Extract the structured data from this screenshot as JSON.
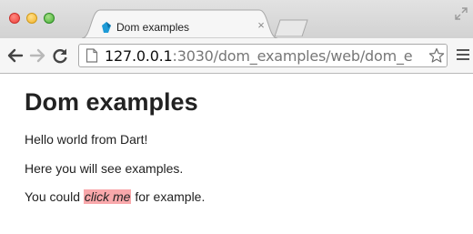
{
  "tab": {
    "title": "Dom examples",
    "close": "×"
  },
  "address_bar": {
    "host": "127.0.0.1",
    "path": ":3030/dom_examples/web/dom_e"
  },
  "page": {
    "heading": "Dom examples",
    "line1": "Hello world from Dart!",
    "line2": "Here you will see examples.",
    "line3_before": "You could ",
    "line3_link": "click me",
    "line3_after": " for example."
  },
  "colors": {
    "highlight": "#f9a8ab",
    "favicon": "#1e9bd7"
  },
  "icons": [
    "back-icon",
    "forward-icon",
    "reload-icon",
    "page-icon",
    "star-icon",
    "menu-icon",
    "close-icon",
    "fullscreen-icon",
    "dart-favicon"
  ]
}
